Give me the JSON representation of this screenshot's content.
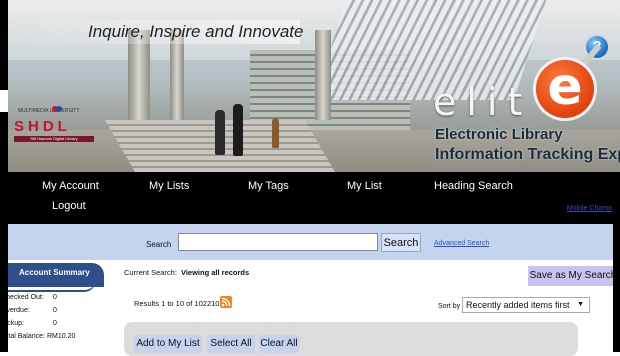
{
  "banner": {
    "tagline": "Inquire, Inspire and Innovate",
    "shdl_logo_university": "MULTIMEDIA UNIVERSITY",
    "shdl_logo_text": "SHDL",
    "shdl_logo_subtitle": "Siti Hasmah Digital Library",
    "elite_word": "elit",
    "elite_e": "e",
    "elite_tagline_1": "Electronic Library",
    "elite_tagline_2": "Information Tracking Expert",
    "help_icon": "?"
  },
  "nav": {
    "my_account": "My Account",
    "logout": "Logout",
    "my_lists": "My Lists",
    "my_tags": "My Tags",
    "my_list": "My List",
    "heading_search": "Heading Search",
    "mobile_link": "Mobile Chamo"
  },
  "search": {
    "label": "Search",
    "input_value": "",
    "button": "Search",
    "advanced_link": "Advanced Search"
  },
  "account_summary": {
    "title": "Account Summary",
    "rows": [
      {
        "label": "Checked Out:",
        "value": "0"
      },
      {
        "label": "Overdue:",
        "value": "0"
      },
      {
        "label": "Pickup:",
        "value": "0"
      },
      {
        "label": "Total Balance:",
        "value": "RM10.20"
      }
    ]
  },
  "results": {
    "current_search_label": "Current Search:",
    "current_search_value": "Viewing all records",
    "save_button": "Save as My Search",
    "summary": "Results 1 to 10 of 102210",
    "sort_label": "Sort by",
    "sort_value": "Recently added items first",
    "actions": {
      "add_to_list": "Add to My List",
      "select_all": "Select All",
      "clear_all": "Clear All"
    }
  },
  "colors": {
    "nav_bg": "#000000",
    "search_bar_bg": "#c4d4ef",
    "account_tab": "#2e4f8b",
    "save_button": "#c9c3f2",
    "rss": "#f0891c",
    "elite_orange": "#e2410c",
    "link": "#2a52be"
  }
}
